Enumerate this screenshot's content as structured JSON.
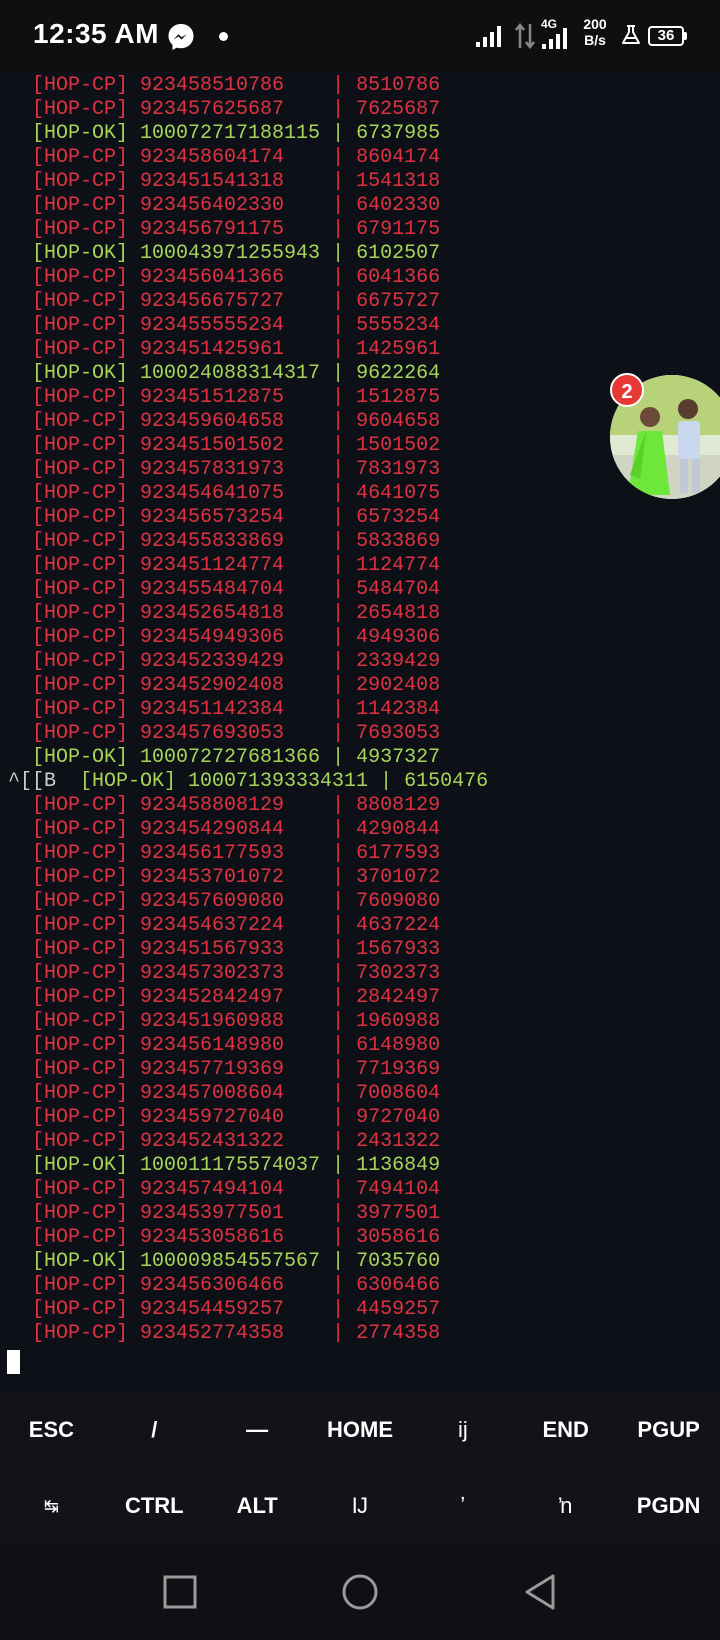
{
  "status_bar": {
    "time": "12:35 AM",
    "network_type": "4G",
    "speed_value": "200",
    "speed_unit": "B/s",
    "battery": "36",
    "icons": [
      "messenger-icon",
      "notification-dot-icon",
      "signal-icon",
      "data-arrows-icon",
      "signal-icon",
      "flask-icon",
      "battery-icon"
    ]
  },
  "terminal": {
    "lines": [
      {
        "text": "[HOP-CP] 923458510786    | 8510786",
        "status": "cp"
      },
      {
        "text": "[HOP-CP] 923457625687    | 7625687",
        "status": "cp"
      },
      {
        "text": "[HOP-OK] 100072717188115 | 6737985",
        "status": "ok"
      },
      {
        "text": "[HOP-CP] 923458604174    | 8604174",
        "status": "cp"
      },
      {
        "text": "[HOP-CP] 923451541318    | 1541318",
        "status": "cp"
      },
      {
        "text": "[HOP-CP] 923456402330    | 6402330",
        "status": "cp"
      },
      {
        "text": "[HOP-CP] 923456791175    | 6791175",
        "status": "cp"
      },
      {
        "text": "[HOP-OK] 100043971255943 | 6102507",
        "status": "ok"
      },
      {
        "text": "[HOP-CP] 923456041366    | 6041366",
        "status": "cp"
      },
      {
        "text": "[HOP-CP] 923456675727    | 6675727",
        "status": "cp"
      },
      {
        "text": "[HOP-CP] 923455555234    | 5555234",
        "status": "cp"
      },
      {
        "text": "[HOP-CP] 923451425961    | 1425961",
        "status": "cp"
      },
      {
        "text": "[HOP-OK] 100024088314317 | 9622264",
        "status": "ok"
      },
      {
        "text": "[HOP-CP] 923451512875    | 1512875",
        "status": "cp"
      },
      {
        "text": "[HOP-CP] 923459604658    | 9604658",
        "status": "cp"
      },
      {
        "text": "[HOP-CP] 923451501502    | 1501502",
        "status": "cp"
      },
      {
        "text": "[HOP-CP] 923457831973    | 7831973",
        "status": "cp"
      },
      {
        "text": "[HOP-CP] 923454641075    | 4641075",
        "status": "cp"
      },
      {
        "text": "[HOP-CP] 923456573254    | 6573254",
        "status": "cp"
      },
      {
        "text": "[HOP-CP] 923455833869    | 5833869",
        "status": "cp"
      },
      {
        "text": "[HOP-CP] 923451124774    | 1124774",
        "status": "cp"
      },
      {
        "text": "[HOP-CP] 923455484704    | 5484704",
        "status": "cp"
      },
      {
        "text": "[HOP-CP] 923452654818    | 2654818",
        "status": "cp"
      },
      {
        "text": "[HOP-CP] 923454949306    | 4949306",
        "status": "cp"
      },
      {
        "text": "[HOP-CP] 923452339429    | 2339429",
        "status": "cp"
      },
      {
        "text": "[HOP-CP] 923452902408    | 2902408",
        "status": "cp"
      },
      {
        "text": "[HOP-CP] 923451142384    | 1142384",
        "status": "cp"
      },
      {
        "text": "[HOP-CP] 923457693053    | 7693053",
        "status": "cp"
      },
      {
        "text": "[HOP-OK] 100072727681366 | 4937327",
        "status": "ok"
      },
      {
        "text": "[HOP-OK] 100071393334311 | 6150476",
        "status": "ok",
        "prefix": "^[[B  "
      },
      {
        "text": "[HOP-CP] 923458808129    | 8808129",
        "status": "cp"
      },
      {
        "text": "[HOP-CP] 923454290844    | 4290844",
        "status": "cp"
      },
      {
        "text": "[HOP-CP] 923456177593    | 6177593",
        "status": "cp"
      },
      {
        "text": "[HOP-CP] 923453701072    | 3701072",
        "status": "cp"
      },
      {
        "text": "[HOP-CP] 923457609080    | 7609080",
        "status": "cp"
      },
      {
        "text": "[HOP-CP] 923454637224    | 4637224",
        "status": "cp"
      },
      {
        "text": "[HOP-CP] 923451567933    | 1567933",
        "status": "cp"
      },
      {
        "text": "[HOP-CP] 923457302373    | 7302373",
        "status": "cp"
      },
      {
        "text": "[HOP-CP] 923452842497    | 2842497",
        "status": "cp"
      },
      {
        "text": "[HOP-CP] 923451960988    | 1960988",
        "status": "cp"
      },
      {
        "text": "[HOP-CP] 923456148980    | 6148980",
        "status": "cp"
      },
      {
        "text": "[HOP-CP] 923457719369    | 7719369",
        "status": "cp"
      },
      {
        "text": "[HOP-CP] 923457008604    | 7008604",
        "status": "cp"
      },
      {
        "text": "[HOP-CP] 923459727040    | 9727040",
        "status": "cp"
      },
      {
        "text": "[HOP-CP] 923452431322    | 2431322",
        "status": "cp"
      },
      {
        "text": "[HOP-OK] 100011175574037 | 1136849",
        "status": "ok"
      },
      {
        "text": "[HOP-CP] 923457494104    | 7494104",
        "status": "cp"
      },
      {
        "text": "[HOP-CP] 923453977501    | 3977501",
        "status": "cp"
      },
      {
        "text": "[HOP-CP] 923453058616    | 3058616",
        "status": "cp"
      },
      {
        "text": "[HOP-OK] 100009854557567 | 7035760",
        "status": "ok"
      },
      {
        "text": "[HOP-CP] 923456306466    | 6306466",
        "status": "cp"
      },
      {
        "text": "[HOP-CP] 923454459257    | 4459257",
        "status": "cp"
      },
      {
        "text": "[HOP-CP] 923452774358    | 2774358",
        "status": "cp"
      }
    ],
    "colors": {
      "cp": "#e03240",
      "ok": "#a6d55a",
      "background": "#0d1117"
    }
  },
  "chat_head": {
    "badge_count": "2"
  },
  "extra_keys": {
    "row1": [
      "ESC",
      "/",
      "—",
      "HOME",
      "ij",
      "END",
      "PGUP"
    ],
    "row2": [
      "↹",
      "CTRL",
      "ALT",
      "Ĳ",
      "ʼ",
      "ŉ",
      "PGDN"
    ]
  },
  "nav_bar": {
    "buttons": [
      "recents-square-icon",
      "home-circle-icon",
      "back-triangle-icon"
    ]
  }
}
